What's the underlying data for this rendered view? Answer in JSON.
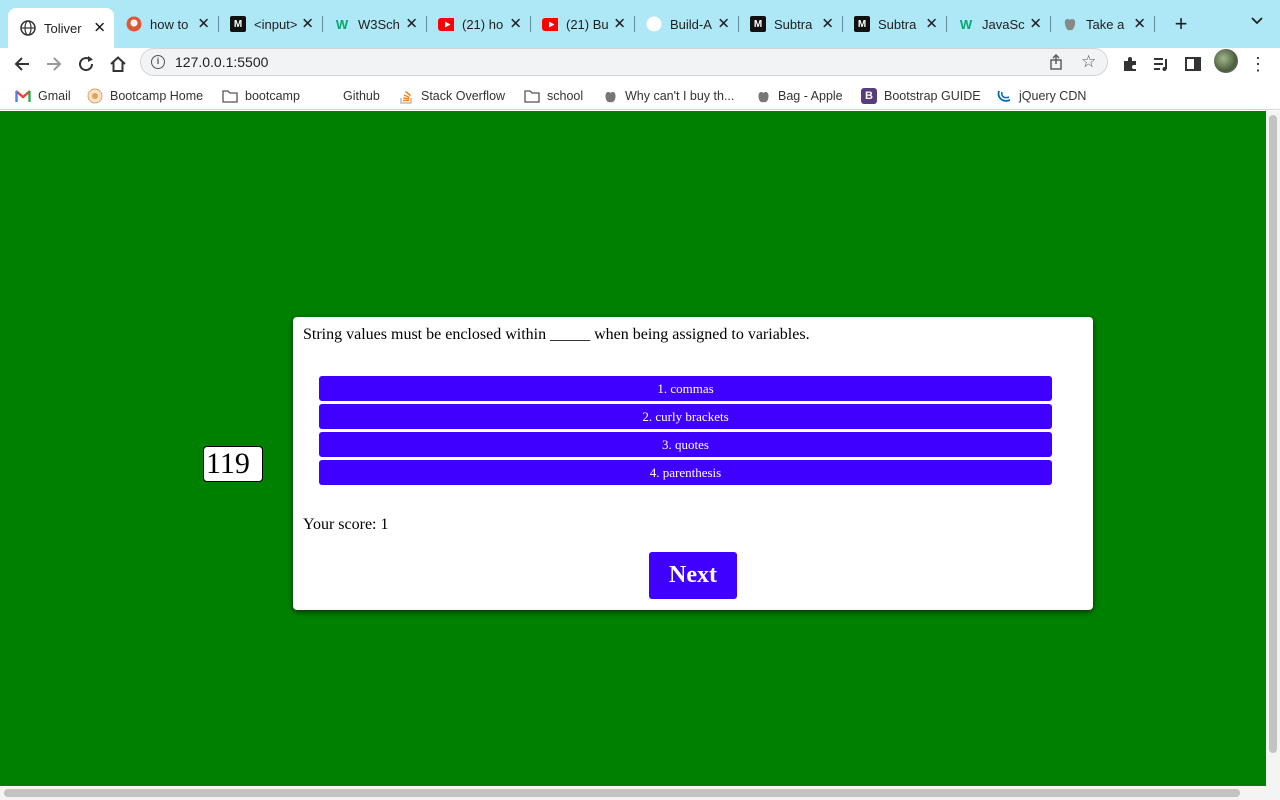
{
  "browser": {
    "tabs": [
      {
        "title": "Toliver",
        "icon": "globe-icon",
        "active": true
      },
      {
        "title": "how to",
        "icon": "duckduckgo-icon"
      },
      {
        "title": "<input>",
        "icon": "codepen-icon"
      },
      {
        "title": "W3Sch",
        "icon": "w3schools-icon"
      },
      {
        "title": "(21) ho",
        "icon": "youtube-icon"
      },
      {
        "title": "(21) Bu",
        "icon": "youtube-icon"
      },
      {
        "title": "Build-A",
        "icon": "github-icon"
      },
      {
        "title": "Subtra",
        "icon": "codepen-icon"
      },
      {
        "title": "Subtra",
        "icon": "codepen-icon"
      },
      {
        "title": "JavaSc",
        "icon": "w3schools-icon"
      },
      {
        "title": "Take a",
        "icon": "apple-icon"
      }
    ],
    "address_bar": {
      "url": "127.0.0.1:5500"
    },
    "bookmarks": [
      {
        "label": "Gmail",
        "icon": "gmail-icon"
      },
      {
        "label": "Bootcamp Home",
        "icon": "bootcamp-icon"
      },
      {
        "label": "bootcamp",
        "icon": "folder-icon"
      },
      {
        "label": "Github",
        "icon": "github-icon"
      },
      {
        "label": "Stack Overflow",
        "icon": "stackoverflow-icon"
      },
      {
        "label": "school",
        "icon": "folder-icon"
      },
      {
        "label": "Why can't I buy th...",
        "icon": "apple-icon"
      },
      {
        "label": "Bag - Apple",
        "icon": "apple-icon"
      },
      {
        "label": "Bootstrap GUIDE",
        "icon": "bootstrap-icon"
      },
      {
        "label": "jQuery CDN",
        "icon": "jquery-icon"
      }
    ]
  },
  "quiz": {
    "timer": "119",
    "question": "String values must be enclosed within _____ when being assigned to variables.",
    "answers": [
      "1. commas",
      "2. curly brackets",
      "3. quotes",
      "4. parenthesis"
    ],
    "score_label": "Your score:",
    "score_value": "1",
    "next_label": "Next"
  },
  "colors": {
    "page_background": "#008000",
    "answer_button": "#3f00ff",
    "tabstrip": "#aee7f5"
  }
}
